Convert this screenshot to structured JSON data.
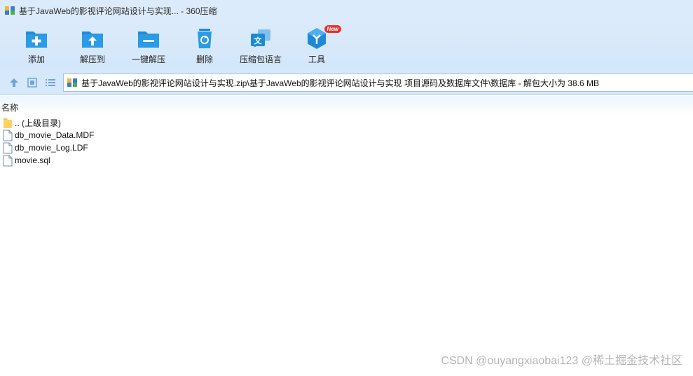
{
  "window": {
    "title": "基于JavaWeb的影视评论网站设计与实现... - 360压缩",
    "app_icon": "archive-app-icon"
  },
  "toolbar": {
    "items": [
      {
        "label": "添加",
        "icon": "add-folder-icon"
      },
      {
        "label": "解压到",
        "icon": "extract-to-folder-icon"
      },
      {
        "label": "一键解压",
        "icon": "one-click-extract-icon"
      },
      {
        "label": "删除",
        "icon": "recycle-bin-icon"
      },
      {
        "label": "压缩包语言",
        "icon": "language-icon"
      },
      {
        "label": "工具",
        "icon": "tools-cube-icon",
        "badge": "New"
      }
    ]
  },
  "nav": {
    "up_icon": "up-arrow-icon",
    "view_icon": "thumbnail-view-icon",
    "list_icon": "list-view-icon",
    "address": "基于JavaWeb的影视评论网站设计与实现.zip\\基于JavaWeb的影视评论网站设计与实现 项目源码及数据库文件\\数据库 - 解包大小为 38.6 MB"
  },
  "list": {
    "column_name": "名称",
    "files": [
      {
        "name": ".. (上级目录)",
        "icon": "folder-icon"
      },
      {
        "name": "db_movie_Data.MDF",
        "icon": "file-icon"
      },
      {
        "name": "db_movie_Log.LDF",
        "icon": "file-icon"
      },
      {
        "name": "movie.sql",
        "icon": "file-icon"
      }
    ]
  },
  "watermark": "CSDN @ouyangxiaobai123 @稀土掘金技术社区",
  "colors": {
    "accent": "#1e8ad6",
    "badge": "#e8322c",
    "toolbar_bg": "#dcebfb"
  }
}
